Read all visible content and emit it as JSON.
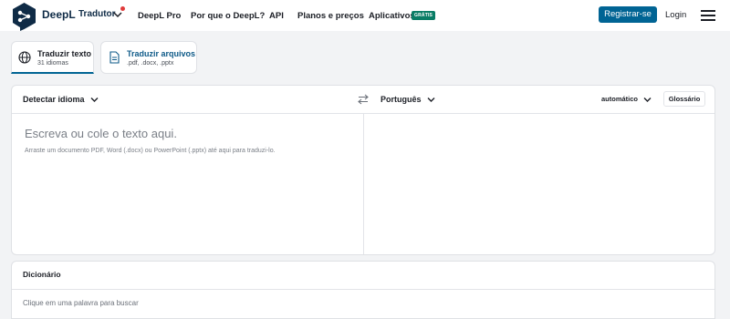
{
  "header": {
    "brand": "DeepL",
    "brand_sub": "Tradutor",
    "nav": [
      "DeepL Pro",
      "Por que o DeepL?",
      "API",
      "Planos e preços",
      "Aplicativos"
    ],
    "free_badge": "GRÁTIS",
    "register_label": "Registrar-se",
    "login_label": "Login",
    "brand_color": "#0f2b46",
    "accent_color": "#006494"
  },
  "tabs": [
    {
      "title": "Traduzir texto",
      "subtitle": "31 idiomas",
      "icon": "globe-icon",
      "active": true
    },
    {
      "title": "Traduzir arquivos",
      "subtitle": ".pdf, .docx, .pptx",
      "icon": "document-icon",
      "active": false
    }
  ],
  "translator": {
    "source_language": "Detectar idioma",
    "target_language": "Português",
    "formality": "automático",
    "glossary_label": "Glossário",
    "placeholder": "Escreva ou cole o texto aqui.",
    "hint": "Arraste um documento PDF, Word (.docx) ou PowerPoint (.pptx) até aqui para traduzi-lo."
  },
  "dictionary": {
    "title": "Dicionário",
    "hint": "Clique em uma palavra para buscar"
  }
}
